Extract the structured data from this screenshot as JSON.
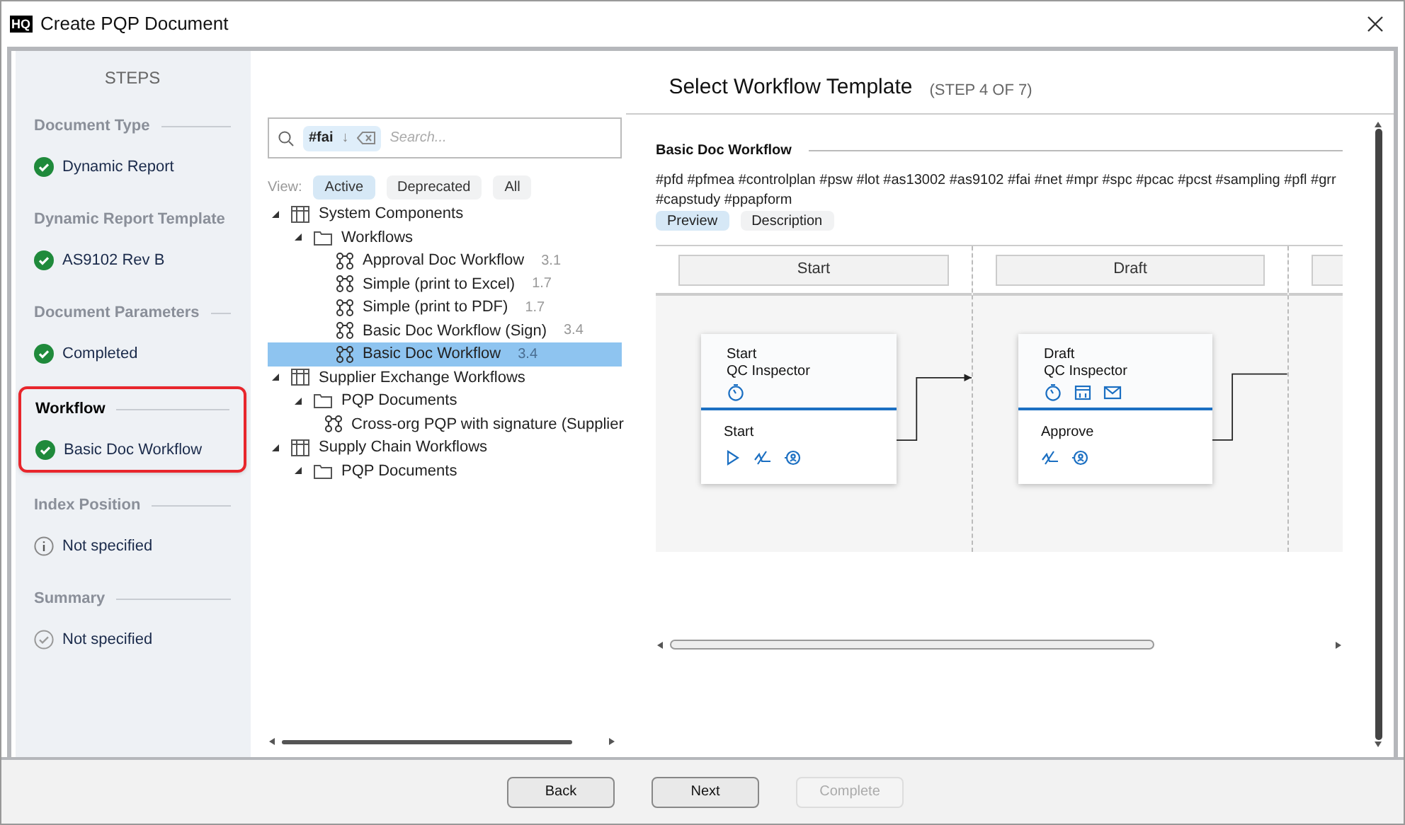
{
  "window": {
    "title": "Create PQP Document",
    "logo": "HQ"
  },
  "steps": {
    "heading": "STEPS",
    "items": [
      {
        "title": "Document Type",
        "value": "Dynamic Report",
        "kind": "done",
        "selected": false
      },
      {
        "title": "Dynamic Report Template",
        "value": "AS9102 Rev B",
        "kind": "done",
        "selected": false
      },
      {
        "title": "Document Parameters",
        "value": "Completed",
        "kind": "done",
        "selected": false
      },
      {
        "title": "Workflow",
        "value": "Basic Doc Workflow",
        "kind": "done",
        "selected": true
      },
      {
        "title": "Index Position",
        "value": "Not specified",
        "kind": "info",
        "selected": false
      },
      {
        "title": "Summary",
        "value": "Not specified",
        "kind": "pending",
        "selected": false
      }
    ]
  },
  "header": {
    "title": "Select Workflow Template",
    "step": "(STEP 4 OF 7)"
  },
  "search": {
    "tag": "#fai",
    "sort": "↓",
    "placeholder": "Search..."
  },
  "view": {
    "label": "View:",
    "options": [
      {
        "label": "Active",
        "selected": true
      },
      {
        "label": "Deprecated",
        "selected": false
      },
      {
        "label": "All",
        "selected": false
      }
    ]
  },
  "tree": [
    {
      "label": "System Components",
      "kind": "group",
      "expanded": true,
      "children": [
        {
          "label": "Workflows",
          "kind": "folder",
          "expanded": true,
          "children": [
            {
              "label": "Approval Doc Workflow",
              "version": "3.1",
              "kind": "workflow",
              "selected": false
            },
            {
              "label": "Simple (print to Excel)",
              "version": "1.7",
              "kind": "workflow",
              "selected": false
            },
            {
              "label": "Simple (print to PDF)",
              "version": "1.7",
              "kind": "workflow",
              "selected": false
            },
            {
              "label": "Basic Doc Workflow (Sign)",
              "version": "3.4",
              "kind": "workflow",
              "selected": false
            },
            {
              "label": "Basic Doc Workflow",
              "version": "3.4",
              "kind": "workflow",
              "selected": true
            }
          ]
        }
      ]
    },
    {
      "label": "Supplier Exchange Workflows",
      "kind": "group",
      "expanded": true,
      "children": [
        {
          "label": "PQP Documents",
          "kind": "folder",
          "expanded": true,
          "children": [
            {
              "label": "Cross-org PQP with signature (Supplier",
              "kind": "workflow",
              "selected": false
            }
          ]
        }
      ]
    },
    {
      "label": "Supply Chain Workflows",
      "kind": "group",
      "expanded": true,
      "children": [
        {
          "label": "PQP Documents",
          "kind": "folder",
          "expanded": true
        }
      ]
    }
  ],
  "preview": {
    "title": "Basic Doc Workflow",
    "tags": "#pfd #pfmea #controlplan #psw #lot #as13002 #as9102 #fai #net #mpr #spc #pcac #pcst #sampling #pfl #grr #capstudy #ppapform",
    "tabs": [
      {
        "label": "Preview",
        "selected": true
      },
      {
        "label": "Description",
        "selected": false
      }
    ],
    "lanes": [
      "Start",
      "Draft"
    ],
    "nodes": [
      {
        "title": "Start",
        "role": "QC Inspector",
        "action": "Start",
        "kind": "start"
      },
      {
        "title": "Draft",
        "role": "QC Inspector",
        "action": "Approve",
        "kind": "task"
      }
    ]
  },
  "buttons": [
    {
      "label": "Back",
      "disabled": false
    },
    {
      "label": "Next",
      "disabled": false
    },
    {
      "label": "Complete",
      "disabled": true
    }
  ]
}
